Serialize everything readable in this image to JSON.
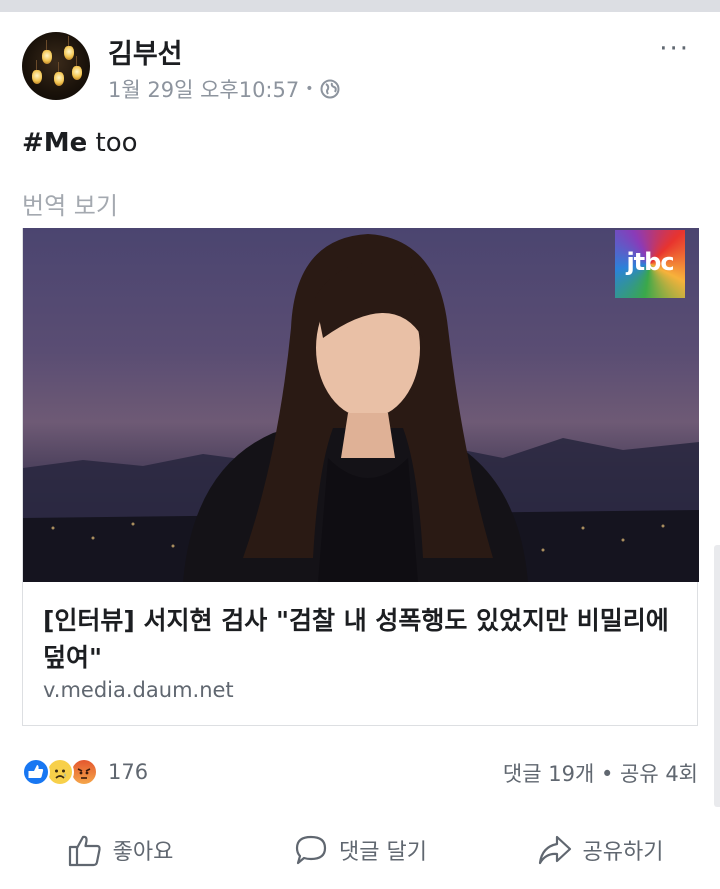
{
  "post": {
    "author": "김부선",
    "timestamp": "1월 29일 오후10:57",
    "separator": "•",
    "privacy_icon": "globe-icon",
    "more_label": "···",
    "text_hashtag": "#Me",
    "text_rest": " too",
    "translate_label": "번역 보기"
  },
  "link_card": {
    "title": "[인터뷰] 서지현 검사 \"검찰 내 성폭행도 있었지만 비밀리에 덮여\"",
    "domain": "v.media.daum.net",
    "logo_text": "jtbc"
  },
  "stats": {
    "reaction_icons": [
      "like-icon",
      "sad-icon",
      "angry-icon"
    ],
    "reaction_count": "176",
    "comments_shares": "댓글 19개 • 공유 4회"
  },
  "actions": {
    "like_label": "좋아요",
    "comment_label": "댓글 달기",
    "share_label": "공유하기"
  },
  "colors": {
    "accent": "#1877f2",
    "text_primary": "#1c1e21",
    "text_secondary": "#606770",
    "text_muted": "#8d949e"
  }
}
